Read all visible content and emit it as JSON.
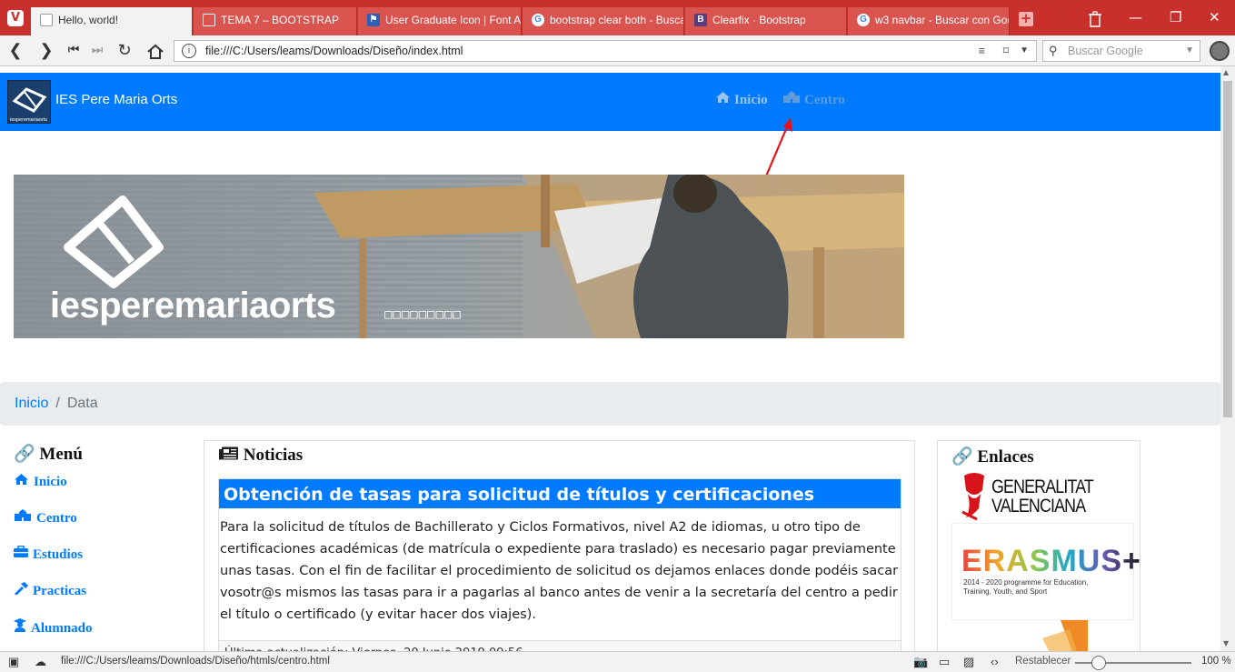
{
  "browser": {
    "tabs": [
      {
        "title": "Hello, world!",
        "icon": "page-icon",
        "active": true
      },
      {
        "title": "TEMA 7 – BOOTSTRAP",
        "icon": "page-icon",
        "active": false
      },
      {
        "title": "User Graduate Icon | Font A",
        "icon": "flag-icon",
        "active": false
      },
      {
        "title": "bootstrap clear both - Busca",
        "icon": "google-icon",
        "active": false
      },
      {
        "title": "Clearfix · Bootstrap",
        "icon": "bootstrap-icon",
        "active": false
      },
      {
        "title": "w3 navbar - Buscar con Goo",
        "icon": "google-icon",
        "active": false
      }
    ],
    "address": "file:///C:/Users/leams/Downloads/Diseño/index.html",
    "search_placeholder": "Buscar Google",
    "status_url": "file:///C:/Users/leams/Downloads/Diseño/htmls/centro.html",
    "reset_label": "Restablecer",
    "zoom": "100 %",
    "zoom_fraction": 0.14,
    "accent": "#c9302c"
  },
  "site": {
    "brand": "IES Pere Maria Orts",
    "logo_caption": "iesperemariaorts",
    "nav": [
      {
        "label": "Inicio",
        "icon": "home-icon"
      },
      {
        "label": "Centro",
        "icon": "school-icon"
      }
    ],
    "banner_text": "iesperemariaorts",
    "banner_sub": "□□□□□□□□□",
    "breadcrumb": {
      "home": "Inicio",
      "separator": "/",
      "current": "Data"
    },
    "menu": {
      "title": "Menú",
      "items": [
        {
          "label": "Inicio",
          "icon": "home-icon"
        },
        {
          "label": "Centro",
          "icon": "school-icon"
        },
        {
          "label": "Estudios",
          "icon": "briefcase-icon"
        },
        {
          "label": "Practicas",
          "icon": "hammer-icon"
        },
        {
          "label": "Alumnado",
          "icon": "user-graduate-icon"
        }
      ]
    },
    "news": {
      "title": "Noticias",
      "card_title": "Obtención de tasas para solicitud de títulos y certificaciones",
      "card_body": "Para la solicitud de títulos de Bachillerato y Ciclos Formativos, nivel A2 de idiomas, u otro tipo de certificaciones académicas (de matrícula o expediente para traslado) es necesario pagar previamente unas tasas. Con el fin de facilitar el procedimiento de solicitud os dejamos enlaces donde podéis sacar vosotr@s mismos las tasas para ir a pagarlas al banco antes de venir a la secretaría del centro a pedir el título o certificado (y evitar hacer dos viajes).",
      "card_footer": "Última actualización: Viernes, 20 Junio 2019 09:56"
    },
    "links": {
      "title": "Enlaces",
      "gva_line1": "GENERALITAT",
      "gva_line2": "VALENCIANA",
      "erasmus_word": "ERASMUS+",
      "erasmus_sub1": "2014 - 2020 programme for Education,",
      "erasmus_sub2": "Training, Youth, and Sport"
    },
    "primary_color": "#007bff"
  }
}
